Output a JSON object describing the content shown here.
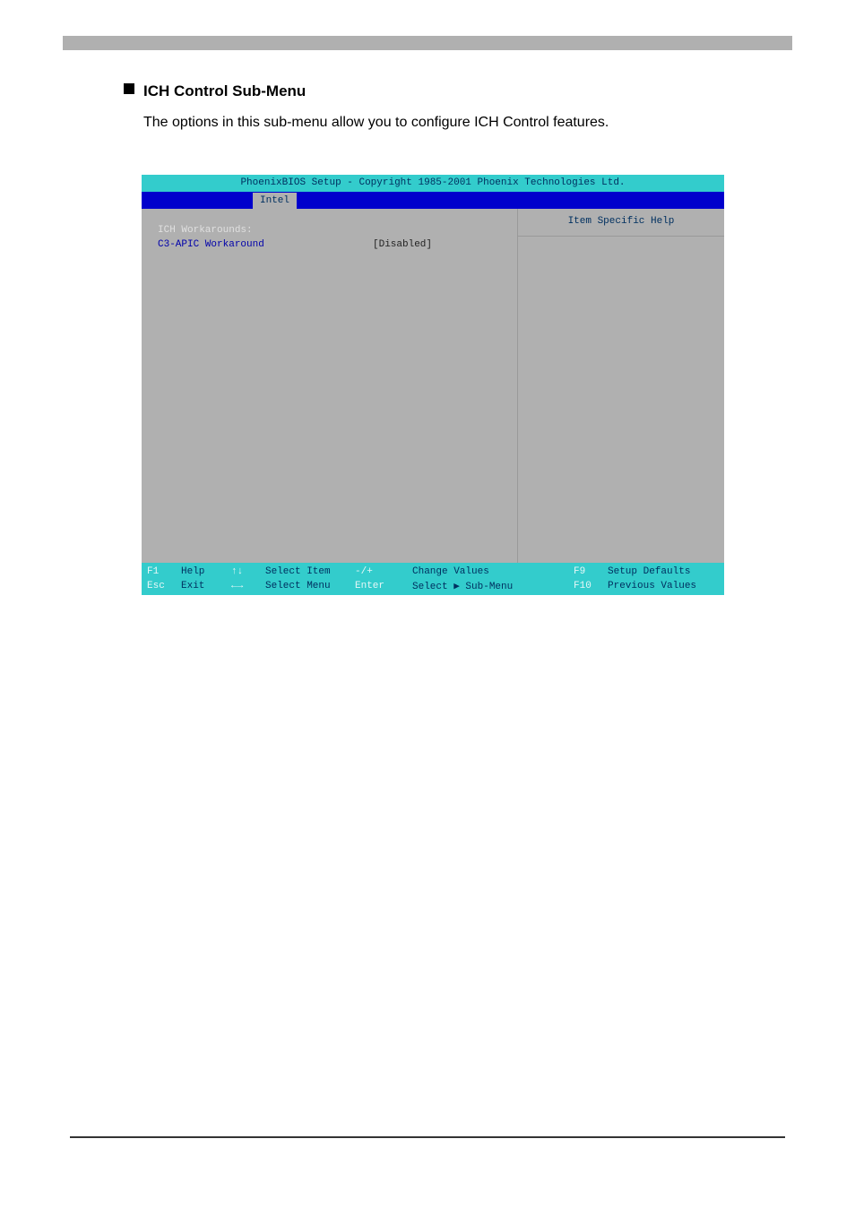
{
  "section": {
    "title": "ICH Control Sub-Menu",
    "desc": "The options in this sub-menu allow you to configure ICH Control features."
  },
  "bios": {
    "title_bar": "PhoenixBIOS Setup - Copyright 1985-2001 Phoenix Technologies Ltd.",
    "menu_tab": "Intel",
    "section_header": "ICH Workarounds:",
    "item_label": "C3-APIC Workaround",
    "item_value": "[Disabled]",
    "help_title": "Item Specific Help"
  },
  "footer": {
    "f1_key": "F1",
    "f1_text": "Help",
    "updown_key": "↑↓",
    "updown_text": "Select Item",
    "pm_key": "-/+",
    "pm_text": "Change Values",
    "f9_key": "F9",
    "f9_text": "Setup Defaults",
    "esc_key": "Esc",
    "esc_text": "Exit",
    "lr_key": "←→",
    "lr_text": "Select Menu",
    "enter_key": "Enter",
    "enter_text": "Select ▶ Sub-Menu",
    "f10_key": "F10",
    "f10_text": "Previous Values"
  }
}
